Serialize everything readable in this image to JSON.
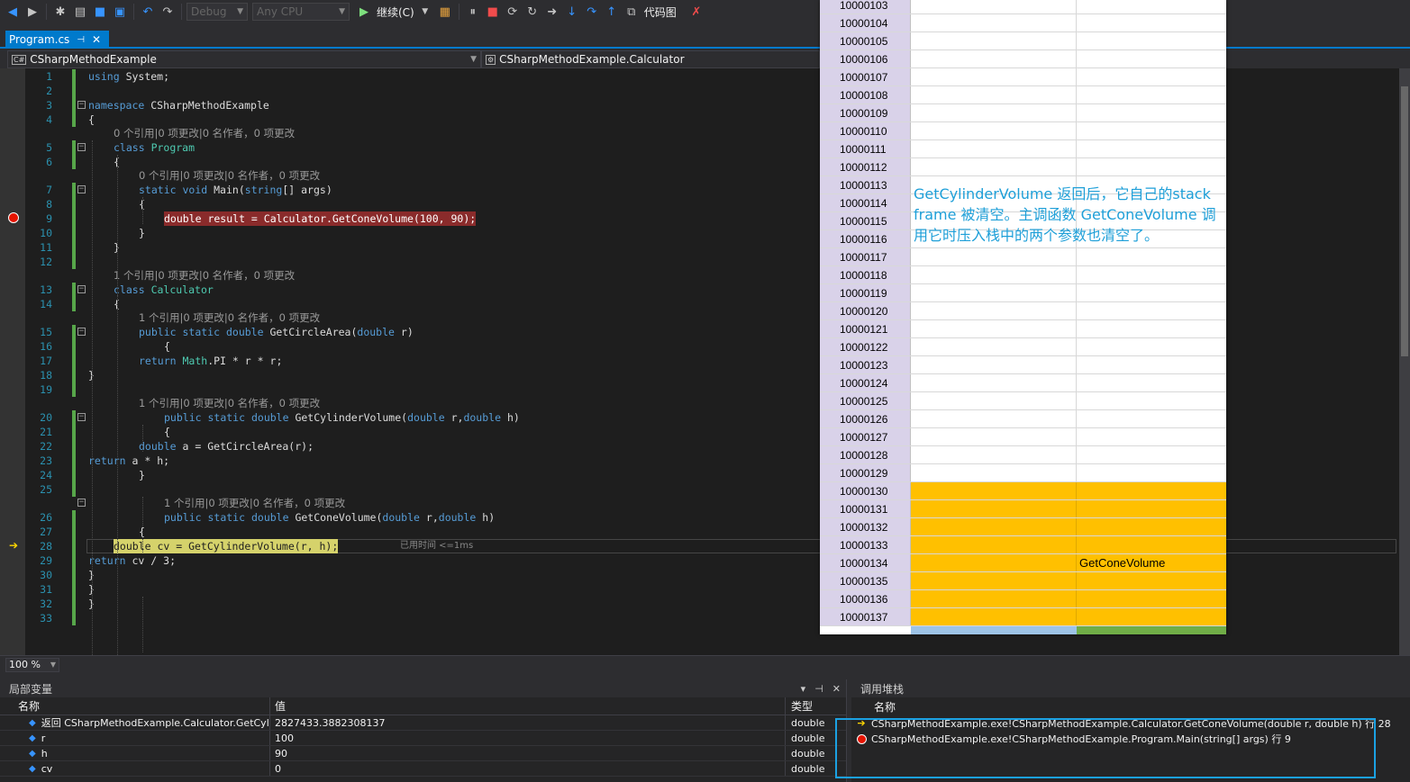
{
  "toolbar": {
    "config": "Debug",
    "platform": "Any CPU",
    "continue_label": "继续(C)",
    "codemap_label": "代码图"
  },
  "tab": {
    "label": "Program.cs"
  },
  "nav": {
    "project": "CSharpMethodExample",
    "member": "CSharpMethodExample.Calculator"
  },
  "editor": {
    "lines": [
      {
        "n": "1",
        "text": "using System;"
      },
      {
        "n": "2",
        "text": ""
      },
      {
        "n": "3",
        "text": "namespace CSharpMethodExample"
      },
      {
        "n": "4",
        "text": "{"
      },
      {
        "lens": "0 个引用|0 项更改|0 名作者，0 项更改"
      },
      {
        "n": "5",
        "text": "class Program"
      },
      {
        "n": "6",
        "text": "{"
      },
      {
        "lens": "0 个引用|0 项更改|0 名作者，0 项更改"
      },
      {
        "n": "7",
        "text": "static void Main(string[] args)"
      },
      {
        "n": "8",
        "text": "{"
      },
      {
        "n": "9",
        "text": "double result = Calculator.GetConeVolume(100, 90);"
      },
      {
        "n": "10",
        "text": "}"
      },
      {
        "n": "11",
        "text": "}"
      },
      {
        "n": "12",
        "text": ""
      },
      {
        "lens": "1 个引用|0 项更改|0 名作者，0 项更改"
      },
      {
        "n": "13",
        "text": "class Calculator"
      },
      {
        "n": "14",
        "text": "{"
      },
      {
        "lens": "1 个引用|0 项更改|0 名作者，0 项更改"
      },
      {
        "n": "15",
        "text": "public static double GetCircleArea(double r)"
      },
      {
        "n": "16",
        "text": "{"
      },
      {
        "n": "17",
        "text": "return Math.PI * r * r;"
      },
      {
        "n": "18",
        "text": "}"
      },
      {
        "n": "19",
        "text": ""
      },
      {
        "lens": "1 个引用|0 项更改|0 名作者，0 项更改"
      },
      {
        "n": "20",
        "text": "public static double GetCylinderVolume(double r,double h)"
      },
      {
        "n": "21",
        "text": "{"
      },
      {
        "n": "22",
        "text": "double a = GetCircleArea(r);"
      },
      {
        "n": "23",
        "text": "return a * h;"
      },
      {
        "n": "24",
        "text": "}"
      },
      {
        "n": "25",
        "text": ""
      },
      {
        "lens": "1 个引用|0 项更改|0 名作者，0 项更改"
      },
      {
        "n": "26",
        "text": "public static double GetConeVolume(double r,double h)"
      },
      {
        "n": "27",
        "text": "{"
      },
      {
        "n": "28",
        "text": "double cv = GetCylinderVolume(r, h);"
      },
      {
        "n": "29",
        "text": "return cv / 3;"
      },
      {
        "n": "30",
        "text": "}"
      },
      {
        "n": "31",
        "text": "}"
      },
      {
        "n": "32",
        "text": "}"
      },
      {
        "n": "33",
        "text": ""
      }
    ],
    "elapsed": "已用时间 <=1ms"
  },
  "zoom": "100 %",
  "locals": {
    "title": "局部变量",
    "headers": {
      "name": "名称",
      "value": "值",
      "type": "类型"
    },
    "rows": [
      {
        "name": "返回 CSharpMethodExample.Calculator.GetCyl",
        "value": "2827433.3882308137",
        "type": "double"
      },
      {
        "name": "r",
        "value": "100",
        "type": "double"
      },
      {
        "name": "h",
        "value": "90",
        "type": "double"
      },
      {
        "name": "cv",
        "value": "0",
        "type": "double"
      }
    ]
  },
  "callstack": {
    "title": "调用堆栈",
    "header": "名称",
    "rows": [
      {
        "text": "CSharpMethodExample.exe!CSharpMethodExample.Calculator.GetConeVolume(double r, double h) 行 28"
      },
      {
        "text": "CSharpMethodExample.exe!CSharpMethodExample.Program.Main(string[] args) 行 9"
      }
    ]
  },
  "memory": {
    "addresses": [
      "10000103",
      "10000104",
      "10000105",
      "10000106",
      "10000107",
      "10000108",
      "10000109",
      "10000110",
      "10000111",
      "10000112",
      "10000113",
      "10000114",
      "10000115",
      "10000116",
      "10000117",
      "10000118",
      "10000119",
      "10000120",
      "10000121",
      "10000122",
      "10000123",
      "10000124",
      "10000125",
      "10000126",
      "10000127",
      "10000128",
      "10000129",
      "10000130",
      "10000131",
      "10000132",
      "10000133",
      "10000134",
      "10000135",
      "10000136",
      "10000137"
    ],
    "first_filled": "10000130",
    "frame_label": "GetConeVolume",
    "frame_label_address": "10000134",
    "note": "GetCylinderVolume 返回后，它自己的stack frame 被清空。主调函数 GetConeVolume 调用它时压入栈中的两个参数也清空了。",
    "colors": {
      "filled": "#ffc000",
      "addr_bg": "#d9d2e9",
      "note": "#1e9fd8"
    }
  }
}
